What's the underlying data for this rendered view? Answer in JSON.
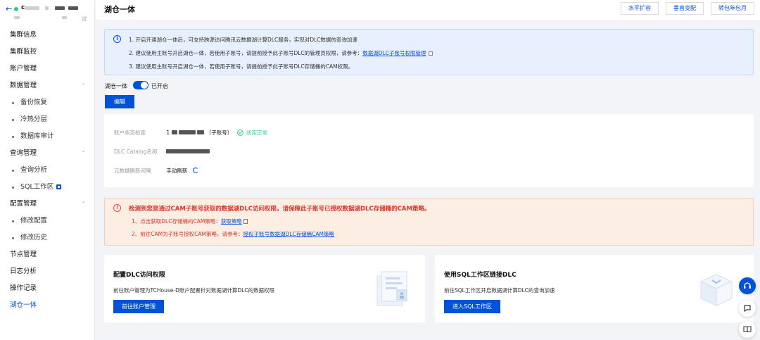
{
  "sidebar": {
    "back_icon": "arrow-left-icon",
    "cluster_name": "c",
    "cluster_sub": "试",
    "items": [
      {
        "label": "集群信息"
      },
      {
        "label": "集群监控"
      },
      {
        "label": "账户管理"
      },
      {
        "label": "数据管理"
      },
      {
        "label": "备份恢复"
      },
      {
        "label": "冷热分层"
      },
      {
        "label": "数据库审计"
      },
      {
        "label": "查询管理"
      },
      {
        "label": "查询分析"
      },
      {
        "label": "SQL工作区"
      },
      {
        "label": "配置管理"
      },
      {
        "label": "修改配置"
      },
      {
        "label": "修改历史"
      },
      {
        "label": "节点管理"
      },
      {
        "label": "日志分析"
      },
      {
        "label": "操作记录"
      },
      {
        "label": "湖仓一体"
      }
    ]
  },
  "header": {
    "title": "湖仓一体",
    "buttons": [
      "水平扩容",
      "垂直变配",
      "转包年包月"
    ]
  },
  "info": {
    "line1": "1. 开启开通湖仓一体后，可支持跨源访问腾讯云数据湖计算DLC服务，实现对DLC数据的查询加速",
    "line2_prefix": "2. 建议使用主账号开启湖仓一体，若使用子账号，请提前授予此子账号DLC的管理员权限，请参考：",
    "line2_link": "数据湖DLC子账号权限管理",
    "line3": "3. 建议使用主账号开启湖仓一体，若使用子账号，请提前授予此子账号DLC存储桶的CAM权限。"
  },
  "toggle": {
    "label": "湖仓一体",
    "state": "已开启",
    "on": true
  },
  "edit_label": "编辑",
  "status": {
    "account_label": "账户状态检查",
    "account_prefix": "1",
    "account_suffix": "（子账号）",
    "account_status": "状态正常",
    "catalog_label": "DLC Catalog名称",
    "refresh_label": "元数据刷新间隔",
    "refresh_value": "手动刷新"
  },
  "warning": {
    "title": "检测到您是通过CAM子账号获取的数据湖DLC访问权限，请保障此子账号已授权数据湖DLC存储桶的CAM策略。",
    "line1_prefix": "1、点击获取DLC存储桶的CAM策略：",
    "line1_link": "获取策略",
    "line2_prefix": "2、前往CAM为子账号授权CAM策略，请参考：",
    "line2_link": "授权子账号数据湖DLC存储桶CAM策略"
  },
  "cards": [
    {
      "title": "配置DLC访问权限",
      "desc": "前往账户管理为TCHouse-D账户配置针对数据湖计算DLC的数据权限",
      "button": "前往账户管理"
    },
    {
      "title": "使用SQL工作区链接DLC",
      "desc": "前往SQL工作区开启数据湖计算DLC的查询加速",
      "button": "进入SQL工作区"
    }
  ],
  "colors": {
    "primary": "#0052d9",
    "success": "#29cc85",
    "danger": "#d9362b",
    "info_bg": "#e8f0fe",
    "warn_bg": "#fdeee4"
  }
}
